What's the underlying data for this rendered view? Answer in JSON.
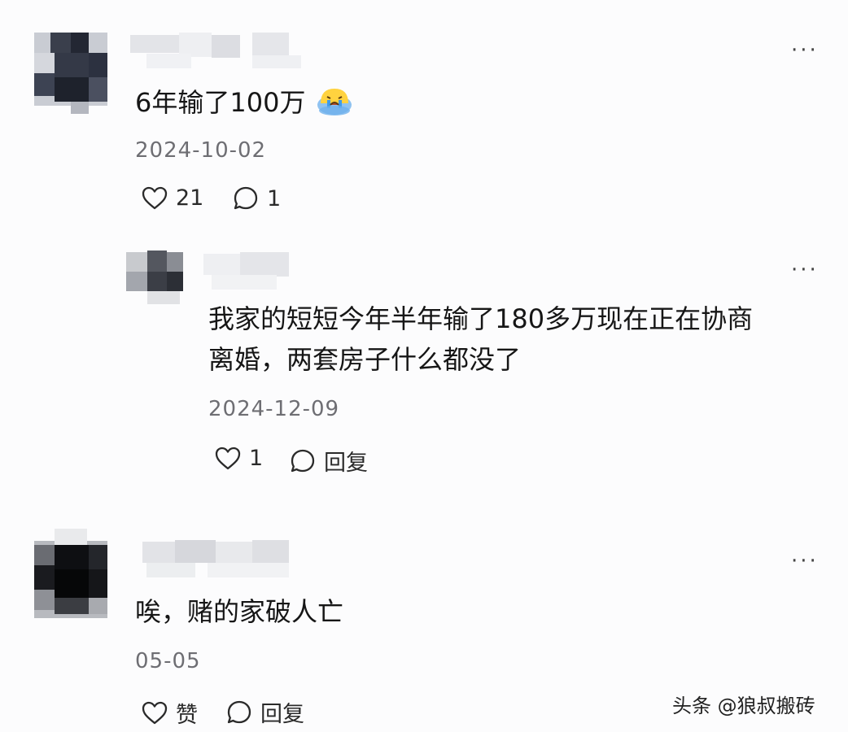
{
  "comments": [
    {
      "text": "6年输了100万",
      "date": "2024-10-02",
      "like_count": "21",
      "reply_count": "1",
      "emoji": "crying-face-emoji",
      "more": "···"
    },
    {
      "text_line1": "我家的短短今年半年输了180多万现在正在协商",
      "text_line2": "离婚，两套房子什么都没了",
      "date": "2024-12-09",
      "like_count": "1",
      "reply_label": "回复",
      "more": "···"
    },
    {
      "text": "唉，赌的家破人亡",
      "date": "05-05",
      "like_label": "赞",
      "reply_label": "回复",
      "more": "···"
    }
  ],
  "watermark": "头条 @狼叔搬砖",
  "icons": {
    "like": "heart-outline-icon",
    "reply": "speech-bubble-icon",
    "more": "ellipsis-icon"
  },
  "colors": {
    "text": "#161616",
    "meta": "#6e6e73",
    "background": "#fcfcfd"
  }
}
